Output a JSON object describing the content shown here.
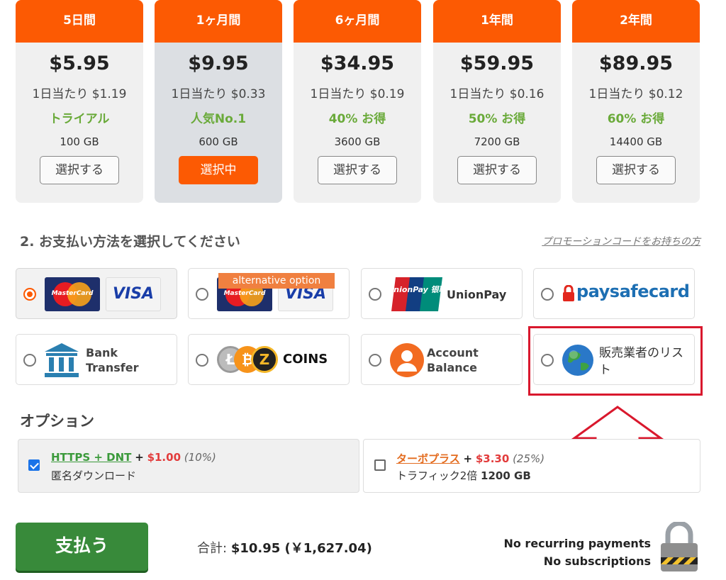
{
  "plans": [
    {
      "name": "5日間",
      "price": "$5.95",
      "daily": "1日当たり $1.19",
      "tag": "トライアル",
      "gb": "100 GB",
      "button": "選択する"
    },
    {
      "name": "1ヶ月間",
      "price": "$9.95",
      "daily": "1日当たり $0.33",
      "tag": "人気No.1",
      "gb": "600 GB",
      "button": "選択中"
    },
    {
      "name": "6ヶ月間",
      "price": "$34.95",
      "daily": "1日当たり $0.19",
      "tag": "40% お得",
      "gb": "3600 GB",
      "button": "選択する"
    },
    {
      "name": "1年間",
      "price": "$59.95",
      "daily": "1日当たり $0.16",
      "tag": "50% お得",
      "gb": "7200 GB",
      "button": "選択する"
    },
    {
      "name": "2年間",
      "price": "$89.95",
      "daily": "1日当たり $0.12",
      "tag": "60% お得",
      "gb": "14400 GB",
      "button": "選択する"
    }
  ],
  "payment": {
    "title": "2. お支払い方法を選択してください",
    "promo": "プロモーションコードをお持ちの方",
    "card_mastercard": "MasterCard",
    "card_visa": "VISA",
    "alternative_badge": "alternative option",
    "unionpay_logo": "UnionPay 银联",
    "unionpay": "UnionPay",
    "paysafecard": "paysafecard",
    "bank_line1": "Bank",
    "bank_line2": "Transfer",
    "coins": "COINS",
    "account_line1": "Account",
    "account_line2": "Balance",
    "vendor_list": "販売業者のリスト"
  },
  "options": {
    "title": "オプション",
    "https_link": "HTTPS + DNT",
    "https_price": "$1.00",
    "https_pct": "(10%)",
    "https_desc": "匿名ダウンロード",
    "turbo_link": "ターボプラス",
    "turbo_price": "$3.30",
    "turbo_pct": "(25%)",
    "turbo_desc": "トラフィック2倍",
    "turbo_gb": "1200 GB",
    "plus": "+"
  },
  "checkout": {
    "pay_button": "支払う",
    "total_label": "合計:",
    "total_value": "$10.95 (￥1,627.04)",
    "no_recurring": "No recurring payments",
    "no_subscriptions": "No subscriptions"
  },
  "colors": {
    "accent": "#fc5a03",
    "green": "#388a3a",
    "annotation": "#d9182d"
  }
}
